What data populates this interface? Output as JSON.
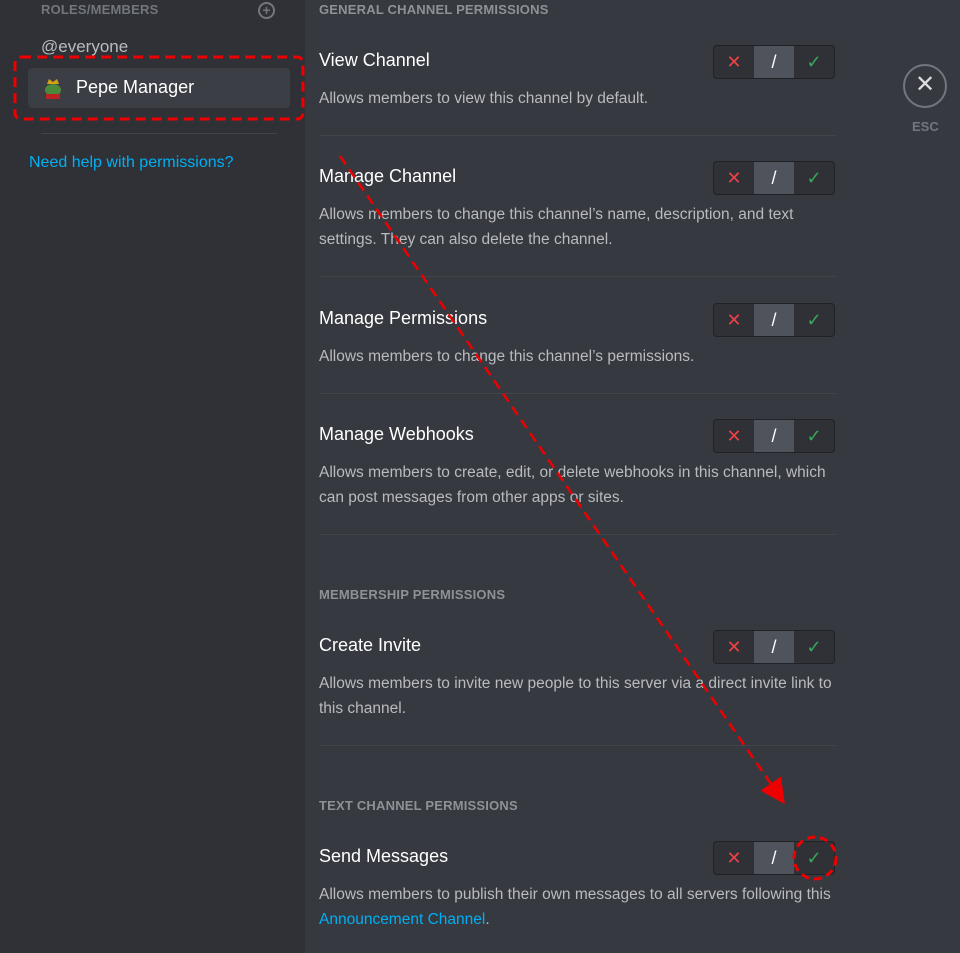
{
  "sidebar": {
    "header": "ROLES/MEMBERS",
    "everyone": "@everyone",
    "selected_role": "Pepe Manager",
    "help_link": "Need help with permissions?"
  },
  "close": {
    "label": "ESC"
  },
  "toggle": {
    "deny": "✕",
    "neutral": "/",
    "allow": "✓"
  },
  "sections": {
    "general": "GENERAL CHANNEL PERMISSIONS",
    "membership": "MEMBERSHIP PERMISSIONS",
    "text": "TEXT CHANNEL PERMISSIONS"
  },
  "permissions": [
    {
      "title": "View Channel",
      "desc": "Allows members to view this channel by default."
    },
    {
      "title": "Manage Channel",
      "desc": "Allows members to change this channel’s name, description, and text settings. They can also delete the channel."
    },
    {
      "title": "Manage Permissions",
      "desc": "Allows members to change this channel’s permissions."
    },
    {
      "title": "Manage Webhooks",
      "desc": "Allows members to create, edit, or delete webhooks in this channel, which can post messages from other apps or sites."
    },
    {
      "title": "Create Invite",
      "desc": "Allows members to invite new people to this server via a direct invite link to this channel."
    },
    {
      "title": "Send Messages",
      "desc": "Allows members to publish their own messages to all servers following this ",
      "link": "Announcement Channel",
      "desc_end": "."
    }
  ]
}
